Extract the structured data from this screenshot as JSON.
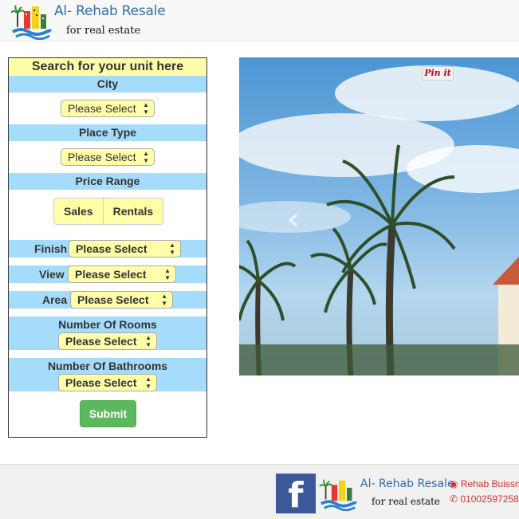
{
  "header": {
    "brand_name": "Al- Rehab Resale",
    "tagline": "for real estate"
  },
  "search": {
    "title": "Search for your unit here",
    "city_label": "City",
    "city_value": "Please Select",
    "place_type_label": "Place Type",
    "place_type_value": "Please Select",
    "price_range_label": "Price Range",
    "sales_label": "Sales",
    "rentals_label": "Rentals",
    "finish_label": "Finish",
    "finish_value": "Please Select",
    "view_label": "View",
    "view_value": "Please Select",
    "area_label": "Area",
    "area_value": "Please Select",
    "rooms_label": "Number Of Rooms",
    "rooms_value": "Please Select",
    "bathrooms_label": "Number Of Bathrooms",
    "bathrooms_value": "Please Select",
    "submit_label": "Submit"
  },
  "carousel": {
    "pin_label": "Pin it",
    "prev_icon": "‹"
  },
  "footer": {
    "facebook_icon": "f",
    "brand_name": "Al- Rehab Resale",
    "tagline": "for real estate",
    "address": "Rehab Buissn",
    "phone": "01002597258"
  },
  "colors": {
    "band": "#a6dcfb",
    "select_bg": "#ffffaa",
    "submit": "#5cb85c",
    "brand_blue": "#2f6eaf",
    "contact_red": "#d9302e"
  }
}
